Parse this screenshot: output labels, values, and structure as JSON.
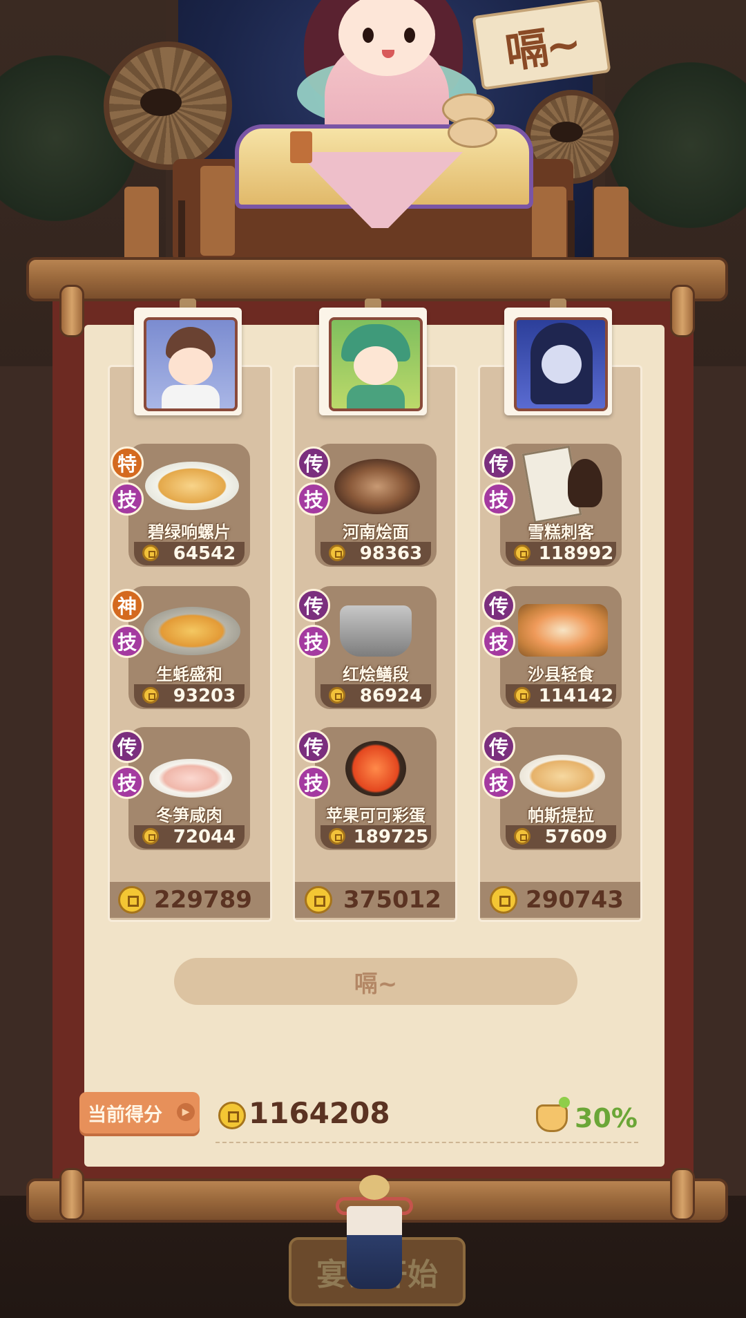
{
  "chef": {
    "speech": "嗝~"
  },
  "columns": [
    {
      "portrait_icon": "boy-chef-portrait",
      "dishes": [
        {
          "name": "碧绿响螺片",
          "value": "64542",
          "rarity": "特",
          "skill": "技",
          "rarity_color": "#d46a1f",
          "icon": "stir-fried-conch-dish"
        },
        {
          "name": "生蚝盛和",
          "value": "93203",
          "rarity": "神",
          "skill": "技",
          "rarity_color": "#d46a1f",
          "icon": "oyster-platter-dish"
        },
        {
          "name": "冬笋咸肉",
          "value": "72044",
          "rarity": "传",
          "skill": "技",
          "rarity_color": "#7b2f7e",
          "icon": "bamboo-shoot-pork-dish"
        }
      ],
      "total": "229789"
    },
    {
      "portrait_icon": "leaf-girl-portrait",
      "dishes": [
        {
          "name": "河南烩面",
          "value": "98363",
          "rarity": "传",
          "skill": "技",
          "rarity_color": "#7b2f7e",
          "icon": "henan-noodle-dish"
        },
        {
          "name": "红烩鳝段",
          "value": "86924",
          "rarity": "传",
          "skill": "技",
          "rarity_color": "#7b2f7e",
          "icon": "braised-eel-pot-dish"
        },
        {
          "name": "苹果可可彩蛋",
          "value": "189725",
          "rarity": "传",
          "skill": "技",
          "rarity_color": "#7b2f7e",
          "icon": "apple-cocoa-egg-dish"
        }
      ],
      "total": "375012"
    },
    {
      "portrait_icon": "ghost-girl-portrait",
      "dishes": [
        {
          "name": "雪糕刺客",
          "value": "118992",
          "rarity": "传",
          "skill": "技",
          "rarity_color": "#7b2f7e",
          "icon": "ice-cream-assassin-dish"
        },
        {
          "name": "沙县轻食",
          "value": "114142",
          "rarity": "传",
          "skill": "技",
          "rarity_color": "#7b2f7e",
          "icon": "shaxian-snack-dish"
        },
        {
          "name": "帕斯提拉",
          "value": "57609",
          "rarity": "传",
          "skill": "技",
          "rarity_color": "#7b2f7e",
          "icon": "pastilla-dish"
        }
      ],
      "total": "290743"
    }
  ],
  "wait_button": "嗝~",
  "score": {
    "label": "当前得分",
    "value": "1164208",
    "bonus": "30%"
  },
  "start_button": "宴会开始",
  "colors": {
    "accent_orange": "#e7905a",
    "bonus_green": "#6ba637",
    "score_brown": "#5b3322"
  }
}
